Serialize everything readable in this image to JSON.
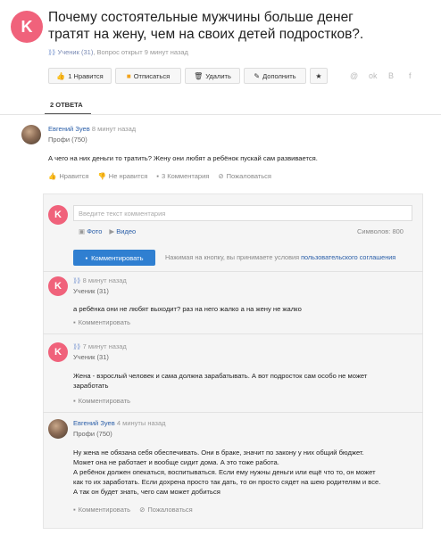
{
  "question": {
    "avatar_letter": "K",
    "title": "Почему состоятельные мужчины больше денег тратят на жену, чем на своих детей подростков?.",
    "author": "Ученик (31)",
    "meta": ", Вопрос открыт 9 минут назад"
  },
  "toolbar": {
    "like_label": "1 Нравится",
    "unsubscribe_label": "Отписаться",
    "delete_label": "Удалить",
    "add_label": "Дополнить"
  },
  "social": {
    "s1": "@",
    "s2": "ok",
    "s3": "B",
    "s4": "f"
  },
  "tabs": {
    "answers_label": "2 ОТВЕТА"
  },
  "answer": {
    "user": "Евгений Зуев",
    "time": "8 минут назад",
    "level": "Профи (750)",
    "text": "А чего на них деньги то тратить? Жену они любят а ребёнок пускай сам развивается.",
    "like": "Нравится",
    "dislike": "Не нравится",
    "comments": "3 Комментария",
    "report": "Пожаловаться"
  },
  "comment_form": {
    "avatar_letter": "K",
    "placeholder": "Введите текст комментария",
    "photo_label": "Фото",
    "video_label": "Видео",
    "chars_label": "Символов: 800",
    "submit_label": "Комментировать",
    "terms_text": "Нажимая на кнопку, вы принимаете условия",
    "terms_link": "пользовательского соглашения"
  },
  "comments": [
    {
      "avatar_letter": "K",
      "time": "8 минут назад",
      "level": "Ученик (31)",
      "text": "а ребёнка они не любят выходит? раз на него жалко а на жену не жалко",
      "action": "Комментировать"
    },
    {
      "avatar_letter": "K",
      "time": "7 минут назад",
      "level": "Ученик (31)",
      "text1": "Жена - взрослый человек и сама должна зарабатывать. А вот подросток сам особо не может",
      "text2": "заработать",
      "action": "Комментировать"
    },
    {
      "user": "Евгений Зуев",
      "time": "4 минуты назад",
      "level": "Профи (750)",
      "lines": [
        "Ну жена не обязана себя обеспечивать. Они в браке, значит по закону у них общий бюджет.",
        "Может она не работает и вообще сидит дома. А это тоже работа.",
        "А ребёнок должен опекаться, воспитываться. Если ему нужны деньги или ещё что то, он может",
        "как то их заработать. Если дохрена просто так дать, то он просто сядет на шею родителям и все.",
        "А так он будет знать, чего сам может добиться"
      ],
      "action": "Комментировать",
      "report": "Пожаловаться"
    }
  ]
}
